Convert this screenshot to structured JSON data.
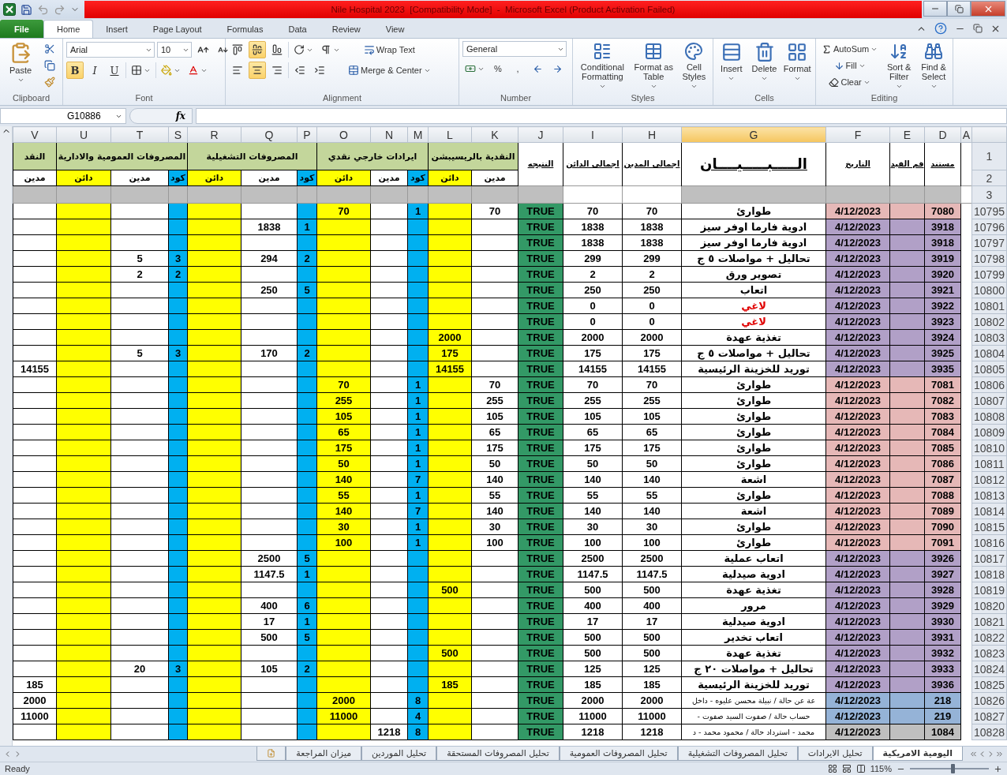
{
  "window": {
    "title": "Nile Hospital 2023  [Compatibility Mode]  -  Microsoft Excel (Product Activation Failed)"
  },
  "ribbon_tabs": [
    {
      "label": "File",
      "kind": "file",
      "selected": false
    },
    {
      "label": "Home",
      "kind": "tab",
      "selected": true
    },
    {
      "label": "Insert",
      "kind": "tab",
      "selected": false
    },
    {
      "label": "Page Layout",
      "kind": "tab",
      "selected": false
    },
    {
      "label": "Formulas",
      "kind": "tab",
      "selected": false
    },
    {
      "label": "Data",
      "kind": "tab",
      "selected": false
    },
    {
      "label": "Review",
      "kind": "tab",
      "selected": false
    },
    {
      "label": "View",
      "kind": "tab",
      "selected": false
    }
  ],
  "ribbon": {
    "clipboard": {
      "group": "Clipboard",
      "paste": "Paste"
    },
    "font": {
      "group": "Font",
      "name": "Arial",
      "size": "10",
      "bold": {
        "label": "B",
        "selected": true
      },
      "italic": {
        "label": "I",
        "selected": false
      },
      "underline": {
        "label": "U",
        "selected": false
      }
    },
    "alignment": {
      "group": "Alignment",
      "vertical": [
        {
          "selected": false
        },
        {
          "selected": true
        },
        {
          "selected": false
        }
      ],
      "horizontal": [
        {
          "selected": false
        },
        {
          "selected": true
        },
        {
          "selected": false
        }
      ],
      "wrap_text": "Wrap Text",
      "merge_center": "Merge & Center"
    },
    "number": {
      "group": "Number",
      "format": "General",
      "percent": "%",
      "comma": ","
    },
    "styles": {
      "group": "Styles",
      "buttons": [
        "Conditional Formatting",
        "Format as Table",
        "Cell Styles"
      ]
    },
    "cells": {
      "group": "Cells",
      "buttons": [
        "Insert",
        "Delete",
        "Format"
      ]
    },
    "editing": {
      "group": "Editing",
      "autosum": "AutoSum",
      "fill": "Fill",
      "clear": "Clear",
      "sort_filter": "Sort & Filter",
      "find_select": "Find & Select"
    }
  },
  "formula_bar": {
    "name_box": "G10886",
    "fx": "fx"
  },
  "columns": [
    {
      "letter": "V",
      "kind": "debit",
      "selected": false
    },
    {
      "letter": "U",
      "kind": "credit",
      "selected": false
    },
    {
      "letter": "T",
      "kind": "debit",
      "selected": false
    },
    {
      "letter": "S",
      "kind": "code",
      "selected": false
    },
    {
      "letter": "R",
      "kind": "credit",
      "selected": false
    },
    {
      "letter": "Q",
      "kind": "debit",
      "selected": false
    },
    {
      "letter": "P",
      "kind": "code",
      "selected": false
    },
    {
      "letter": "O",
      "kind": "credit",
      "selected": false
    },
    {
      "letter": "N",
      "kind": "debit",
      "selected": false
    },
    {
      "letter": "M",
      "kind": "code",
      "selected": false
    },
    {
      "letter": "L",
      "kind": "credit",
      "selected": false
    },
    {
      "letter": "K",
      "kind": "debit",
      "selected": false
    },
    {
      "letter": "J",
      "kind": "result",
      "selected": false
    },
    {
      "letter": "I",
      "kind": "credit_total",
      "selected": false
    },
    {
      "letter": "H",
      "kind": "debit_total",
      "selected": false
    },
    {
      "letter": "G",
      "kind": "description",
      "selected": true
    },
    {
      "letter": "F",
      "kind": "date",
      "selected": false
    },
    {
      "letter": "E",
      "kind": "entry",
      "selected": false
    },
    {
      "letter": "D",
      "kind": "document",
      "selected": false
    },
    {
      "letter": "A",
      "kind": "blank",
      "selected": false
    }
  ],
  "main_headers": [
    "مستند",
    "قم القيد",
    "التاريخ",
    "الـــــبـــــيــــان",
    "اجمالى المدين",
    "اجمالى الدائن",
    "النتيجه"
  ],
  "group_headers": [
    {
      "label": "النقدية بالريسيبشن",
      "sub_headers": [
        "مدين",
        "دائن"
      ]
    },
    {
      "label": "ايرادات خارجي نقدي",
      "sub_headers": [
        "كود",
        "مدين",
        "دائن"
      ]
    },
    {
      "label": "المصروفات التشغيلية",
      "sub_headers": [
        "كود",
        "مدين",
        "دائن"
      ]
    },
    {
      "label": "المصروفات العمومية والادارية",
      "sub_headers": [
        "كود",
        "مدين",
        "دائن"
      ]
    },
    {
      "label": "النقد",
      "sub_headers": [
        "مدين"
      ]
    }
  ],
  "header_row_numbers": [
    "1",
    "2",
    "3"
  ],
  "rows": [
    {
      "num": "10795",
      "doc": "7080",
      "color": "#e6b8b7",
      "date": "4/12/2023",
      "description": "طوارئ",
      "cancelled": false,
      "debit": "70",
      "credit": "70",
      "result": "TRUE",
      "ledger": {
        "K": "70",
        "M": "1",
        "O": "70"
      }
    },
    {
      "num": "10796",
      "doc": "3918",
      "color": "#b1a0c7",
      "date": "4/12/2023",
      "description": "ادوية فارما اوفر سيز",
      "cancelled": false,
      "debit": "1838",
      "credit": "1838",
      "result": "TRUE",
      "ledger": {
        "P": "1",
        "Q": "1838"
      }
    },
    {
      "num": "10797",
      "doc": "3918",
      "color": "#b1a0c7",
      "date": "4/12/2023",
      "description": "ادوية فارما اوفر سيز",
      "cancelled": false,
      "debit": "1838",
      "credit": "1838",
      "result": "TRUE"
    },
    {
      "num": "10798",
      "doc": "3919",
      "color": "#b1a0c7",
      "date": "4/12/2023",
      "description": "تحاليل + مواصلات ٥ ج",
      "cancelled": false,
      "debit": "299",
      "credit": "299",
      "result": "TRUE",
      "ledger": {
        "P": "2",
        "Q": "294",
        "S": "3",
        "T": "5"
      }
    },
    {
      "num": "10799",
      "doc": "3920",
      "color": "#b1a0c7",
      "date": "4/12/2023",
      "description": "تصوير ورق",
      "cancelled": false,
      "debit": "2",
      "credit": "2",
      "result": "TRUE",
      "ledger": {
        "S": "2",
        "T": "2"
      }
    },
    {
      "num": "10800",
      "doc": "3921",
      "color": "#b1a0c7",
      "date": "4/12/2023",
      "description": "اتعاب",
      "cancelled": false,
      "debit": "250",
      "credit": "250",
      "result": "TRUE",
      "ledger": {
        "P": "5",
        "Q": "250"
      }
    },
    {
      "num": "10801",
      "doc": "3922",
      "color": "#b1a0c7",
      "date": "4/12/2023",
      "description": "لاغي",
      "cancelled": true,
      "debit": "0",
      "credit": "0",
      "result": "TRUE"
    },
    {
      "num": "10802",
      "doc": "3923",
      "color": "#b1a0c7",
      "date": "4/12/2023",
      "description": "لاغي",
      "cancelled": true,
      "debit": "0",
      "credit": "0",
      "result": "TRUE"
    },
    {
      "num": "10803",
      "doc": "3924",
      "color": "#b1a0c7",
      "date": "4/12/2023",
      "description": "تغذية عهدة",
      "cancelled": false,
      "debit": "2000",
      "credit": "2000",
      "result": "TRUE",
      "ledger": {
        "L": "2000"
      }
    },
    {
      "num": "10804",
      "doc": "3925",
      "color": "#b1a0c7",
      "date": "4/12/2023",
      "description": "تحاليل + مواصلات ٥ ج",
      "cancelled": false,
      "debit": "175",
      "credit": "175",
      "result": "TRUE",
      "ledger": {
        "L": "175",
        "P": "2",
        "Q": "170",
        "S": "3",
        "T": "5"
      }
    },
    {
      "num": "10805",
      "doc": "3935",
      "color": "#b1a0c7",
      "date": "4/12/2023",
      "description": "توريد للخزينة الرئيسية",
      "cancelled": false,
      "debit": "14155",
      "credit": "14155",
      "result": "TRUE",
      "ledger": {
        "L": "14155",
        "V": "14155"
      }
    },
    {
      "num": "10806",
      "doc": "7081",
      "color": "#e6b8b7",
      "date": "4/12/2023",
      "description": "طوارئ",
      "cancelled": false,
      "debit": "70",
      "credit": "70",
      "result": "TRUE",
      "ledger": {
        "K": "70",
        "M": "1",
        "O": "70"
      }
    },
    {
      "num": "10807",
      "doc": "7082",
      "color": "#e6b8b7",
      "date": "4/12/2023",
      "description": "طوارئ",
      "cancelled": false,
      "debit": "255",
      "credit": "255",
      "result": "TRUE",
      "ledger": {
        "K": "255",
        "M": "1",
        "O": "255"
      }
    },
    {
      "num": "10808",
      "doc": "7083",
      "color": "#e6b8b7",
      "date": "4/12/2023",
      "description": "طوارئ",
      "cancelled": false,
      "debit": "105",
      "credit": "105",
      "result": "TRUE",
      "ledger": {
        "K": "105",
        "M": "1",
        "O": "105"
      }
    },
    {
      "num": "10809",
      "doc": "7084",
      "color": "#e6b8b7",
      "date": "4/12/2023",
      "description": "طوارئ",
      "cancelled": false,
      "debit": "65",
      "credit": "65",
      "result": "TRUE",
      "ledger": {
        "K": "65",
        "M": "1",
        "O": "65"
      }
    },
    {
      "num": "10810",
      "doc": "7085",
      "color": "#e6b8b7",
      "date": "4/12/2023",
      "description": "طوارئ",
      "cancelled": false,
      "debit": "175",
      "credit": "175",
      "result": "TRUE",
      "ledger": {
        "K": "175",
        "M": "1",
        "O": "175"
      }
    },
    {
      "num": "10811",
      "doc": "7086",
      "color": "#e6b8b7",
      "date": "4/12/2023",
      "description": "طوارئ",
      "cancelled": false,
      "debit": "50",
      "credit": "50",
      "result": "TRUE",
      "ledger": {
        "K": "50",
        "M": "1",
        "O": "50"
      }
    },
    {
      "num": "10812",
      "doc": "7087",
      "color": "#e6b8b7",
      "date": "4/12/2023",
      "description": "اشعة",
      "cancelled": false,
      "debit": "140",
      "credit": "140",
      "result": "TRUE",
      "ledger": {
        "K": "140",
        "M": "7",
        "O": "140"
      }
    },
    {
      "num": "10813",
      "doc": "7088",
      "color": "#e6b8b7",
      "date": "4/12/2023",
      "description": "طوارئ",
      "cancelled": false,
      "debit": "55",
      "credit": "55",
      "result": "TRUE",
      "ledger": {
        "K": "55",
        "M": "1",
        "O": "55"
      }
    },
    {
      "num": "10814",
      "doc": "7089",
      "color": "#e6b8b7",
      "date": "4/12/2023",
      "description": "اشعة",
      "cancelled": false,
      "debit": "140",
      "credit": "140",
      "result": "TRUE",
      "ledger": {
        "K": "140",
        "M": "7",
        "O": "140"
      }
    },
    {
      "num": "10815",
      "doc": "7090",
      "color": "#e6b8b7",
      "date": "4/12/2023",
      "description": "طوارئ",
      "cancelled": false,
      "debit": "30",
      "credit": "30",
      "result": "TRUE",
      "ledger": {
        "K": "30",
        "M": "1",
        "O": "30"
      }
    },
    {
      "num": "10816",
      "doc": "7091",
      "color": "#e6b8b7",
      "date": "4/12/2023",
      "description": "طوارئ",
      "cancelled": false,
      "debit": "100",
      "credit": "100",
      "result": "TRUE",
      "ledger": {
        "K": "100",
        "M": "1",
        "O": "100"
      }
    },
    {
      "num": "10817",
      "doc": "3926",
      "color": "#b1a0c7",
      "date": "4/12/2023",
      "description": "اتعاب عملية",
      "cancelled": false,
      "debit": "2500",
      "credit": "2500",
      "result": "TRUE",
      "ledger": {
        "P": "5",
        "Q": "2500"
      }
    },
    {
      "num": "10818",
      "doc": "3927",
      "color": "#b1a0c7",
      "date": "4/12/2023",
      "description": "ادوية صيدلية",
      "cancelled": false,
      "debit": "1147.5",
      "credit": "1147.5",
      "result": "TRUE",
      "ledger": {
        "P": "1",
        "Q": "1147.5"
      }
    },
    {
      "num": "10819",
      "doc": "3928",
      "color": "#b1a0c7",
      "date": "4/12/2023",
      "description": "تغذية عهدة",
      "cancelled": false,
      "debit": "500",
      "credit": "500",
      "result": "TRUE",
      "ledger": {
        "L": "500"
      }
    },
    {
      "num": "10820",
      "doc": "3929",
      "color": "#b1a0c7",
      "date": "4/12/2023",
      "description": "مرور",
      "cancelled": false,
      "debit": "400",
      "credit": "400",
      "result": "TRUE",
      "ledger": {
        "P": "6",
        "Q": "400"
      }
    },
    {
      "num": "10821",
      "doc": "3930",
      "color": "#b1a0c7",
      "date": "4/12/2023",
      "description": "ادوية صيدلية",
      "cancelled": false,
      "debit": "17",
      "credit": "17",
      "result": "TRUE",
      "ledger": {
        "P": "1",
        "Q": "17"
      }
    },
    {
      "num": "10822",
      "doc": "3931",
      "color": "#b1a0c7",
      "date": "4/12/2023",
      "description": "اتعاب تخدير",
      "cancelled": false,
      "debit": "500",
      "credit": "500",
      "result": "TRUE",
      "ledger": {
        "P": "5",
        "Q": "500"
      }
    },
    {
      "num": "10823",
      "doc": "3932",
      "color": "#b1a0c7",
      "date": "4/12/2023",
      "description": "تغذية عهدة",
      "cancelled": false,
      "debit": "500",
      "credit": "500",
      "result": "TRUE",
      "ledger": {
        "L": "500"
      }
    },
    {
      "num": "10824",
      "doc": "3933",
      "color": "#b1a0c7",
      "date": "4/12/2023",
      "description": "تحاليل + مواصلات ٢٠ ج",
      "cancelled": false,
      "debit": "125",
      "credit": "125",
      "result": "TRUE",
      "ledger": {
        "P": "2",
        "Q": "105",
        "S": "3",
        "T": "20"
      }
    },
    {
      "num": "10825",
      "doc": "3936",
      "color": "#b1a0c7",
      "date": "4/12/2023",
      "description": "توريد للخزينة الرئيسية",
      "cancelled": false,
      "debit": "185",
      "credit": "185",
      "result": "TRUE",
      "ledger": {
        "L": "185",
        "V": "185"
      }
    },
    {
      "num": "10826",
      "doc": "218",
      "color": "#95b3d7",
      "date": "4/12/2023",
      "description": "عة عن حالة / نبيلة محسن عليوه - داخل",
      "cancelled": false,
      "debit": "2000",
      "credit": "2000",
      "result": "TRUE",
      "ledger": {
        "M": "8",
        "O": "2000",
        "V": "2000"
      }
    },
    {
      "num": "10827",
      "doc": "219",
      "color": "#95b3d7",
      "date": "4/12/2023",
      "description": "حساب حالة / صفوت السيد صفوت -",
      "cancelled": false,
      "debit": "11000",
      "credit": "11000",
      "result": "TRUE",
      "ledger": {
        "M": "4",
        "O": "11000",
        "V": "11000"
      }
    },
    {
      "num": "10828",
      "doc": "1084",
      "color": "#bfbfbf",
      "date": "4/12/2023",
      "description": "محمد - استرداد حالة / محمود محمد - د",
      "cancelled": false,
      "debit": "1218",
      "credit": "1218",
      "result": "TRUE",
      "ledger": {
        "M": "8",
        "N": "1218"
      }
    }
  ],
  "sheet_tabs": [
    {
      "label": "اليومية الامريكية",
      "selected": true
    },
    {
      "label": "تحليل الايرادات",
      "selected": false
    },
    {
      "label": "تحليل المصروفات التشغيلية",
      "selected": false
    },
    {
      "label": "تحليل المصروفات العمومية",
      "selected": false
    },
    {
      "label": "تحليل المصروفات المستحقة",
      "selected": false
    },
    {
      "label": "تحليل الموردين",
      "selected": false
    },
    {
      "label": "ميزان المراجعة",
      "selected": false
    }
  ],
  "status_bar": {
    "status": "Ready",
    "zoom": {
      "label": "115%",
      "level": 0.55
    }
  }
}
